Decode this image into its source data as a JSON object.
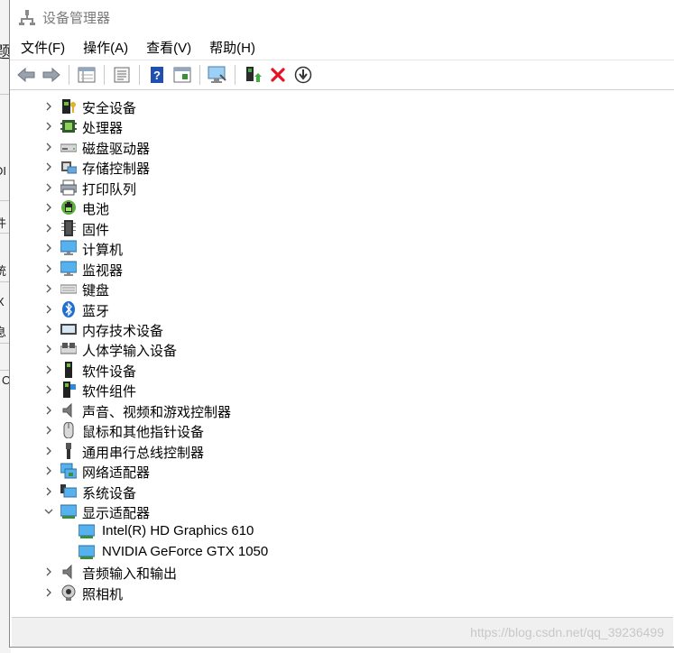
{
  "window": {
    "title": "设备管理器"
  },
  "background_fragments": [
    "题",
    "DI",
    "件",
    "统",
    "X",
    "息",
    "C"
  ],
  "menu": [
    "文件(F)",
    "操作(A)",
    "查看(V)",
    "帮助(H)"
  ],
  "toolbar": {
    "buttons": [
      "back-icon",
      "forward-icon",
      "properties-grid-icon",
      "show-hidden-icon",
      "help-icon",
      "view-icon",
      "monitor-scan-icon",
      "update-driver-icon",
      "uninstall-icon",
      "disable-device-icon"
    ]
  },
  "tree": {
    "items": [
      {
        "label": "安全设备",
        "icon": "security-device-icon",
        "expanded": false
      },
      {
        "label": "处理器",
        "icon": "processor-icon",
        "expanded": false
      },
      {
        "label": "磁盘驱动器",
        "icon": "disk-drive-icon",
        "expanded": false
      },
      {
        "label": "存储控制器",
        "icon": "storage-controller-icon",
        "expanded": false
      },
      {
        "label": "打印队列",
        "icon": "print-queue-icon",
        "expanded": false
      },
      {
        "label": "电池",
        "icon": "battery-icon",
        "expanded": false
      },
      {
        "label": "固件",
        "icon": "firmware-icon",
        "expanded": false
      },
      {
        "label": "计算机",
        "icon": "computer-icon",
        "expanded": false
      },
      {
        "label": "监视器",
        "icon": "monitor-icon",
        "expanded": false
      },
      {
        "label": "键盘",
        "icon": "keyboard-icon",
        "expanded": false
      },
      {
        "label": "蓝牙",
        "icon": "bluetooth-icon",
        "expanded": false
      },
      {
        "label": "内存技术设备",
        "icon": "memory-tech-icon",
        "expanded": false
      },
      {
        "label": "人体学输入设备",
        "icon": "hid-icon",
        "expanded": false
      },
      {
        "label": "软件设备",
        "icon": "software-device-icon",
        "expanded": false
      },
      {
        "label": "软件组件",
        "icon": "software-component-icon",
        "expanded": false
      },
      {
        "label": "声音、视频和游戏控制器",
        "icon": "sound-icon",
        "expanded": false
      },
      {
        "label": "鼠标和其他指针设备",
        "icon": "mouse-icon",
        "expanded": false
      },
      {
        "label": "通用串行总线控制器",
        "icon": "usb-icon",
        "expanded": false
      },
      {
        "label": "网络适配器",
        "icon": "network-adapter-icon",
        "expanded": false
      },
      {
        "label": "系统设备",
        "icon": "system-device-icon",
        "expanded": false
      },
      {
        "label": "显示适配器",
        "icon": "display-adapter-icon",
        "expanded": true,
        "children": [
          {
            "label": "Intel(R) HD Graphics 610",
            "icon": "display-adapter-icon"
          },
          {
            "label": "NVIDIA GeForce GTX 1050",
            "icon": "display-adapter-icon"
          }
        ]
      },
      {
        "label": "音频输入和输出",
        "icon": "audio-io-icon",
        "expanded": false
      },
      {
        "label": "照相机",
        "icon": "camera-icon",
        "expanded": false
      }
    ]
  },
  "status_bar": {
    "watermark": "https://blog.csdn.net/qq_39236499"
  },
  "colors": {
    "red_x": "#e81123",
    "help_blue": "#1f4fb0",
    "monitor_blue": "#3a8fd8",
    "tree_chevron": "#555555"
  }
}
